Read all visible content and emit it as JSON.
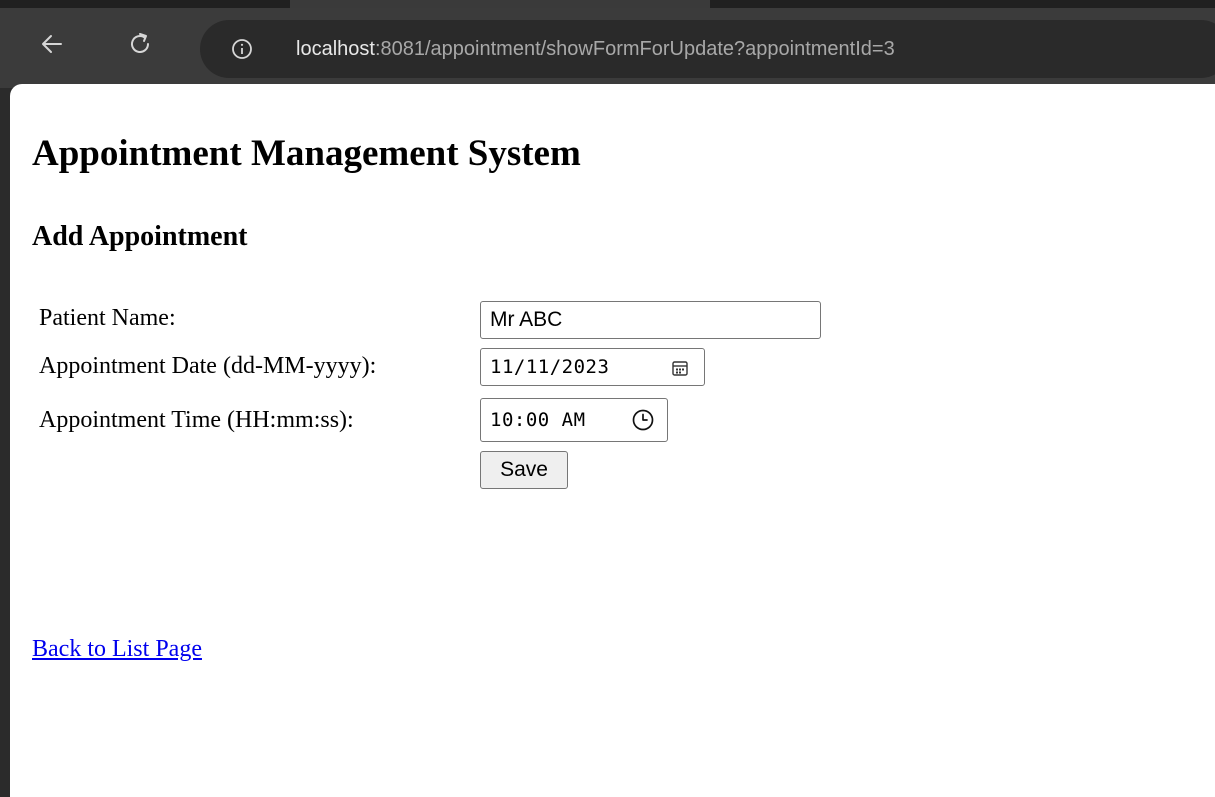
{
  "browser": {
    "url_host": "localhost",
    "url_rest": ":8081/appointment/showFormForUpdate?appointmentId=3",
    "icons": {
      "back": "arrow-left-icon",
      "reload": "reload-icon",
      "info": "info-icon"
    },
    "colors": {
      "toolbar": "#3b3b3b",
      "omnibox": "#2a2a2a",
      "url_host": "#e8e8e8",
      "url_rest": "#a8a8a8"
    }
  },
  "page": {
    "title": "Appointment Management System",
    "subtitle": "Add Appointment",
    "form": {
      "patient_name_label": "Patient Name:",
      "patient_name_value": "Mr ABC",
      "date_label": "Appointment Date (dd-MM-yyyy):",
      "date_value": "11/11/2023",
      "time_label": "Appointment Time (HH:mm:ss):",
      "time_value": "10:00 AM",
      "save_label": "Save",
      "icons": {
        "date_picker": "calendar-icon",
        "time_picker": "clock-icon"
      }
    },
    "back_link": "Back to List Page",
    "colors": {
      "link": "#0000ee",
      "button_bg": "#efefef",
      "field_border": "#767676"
    }
  }
}
